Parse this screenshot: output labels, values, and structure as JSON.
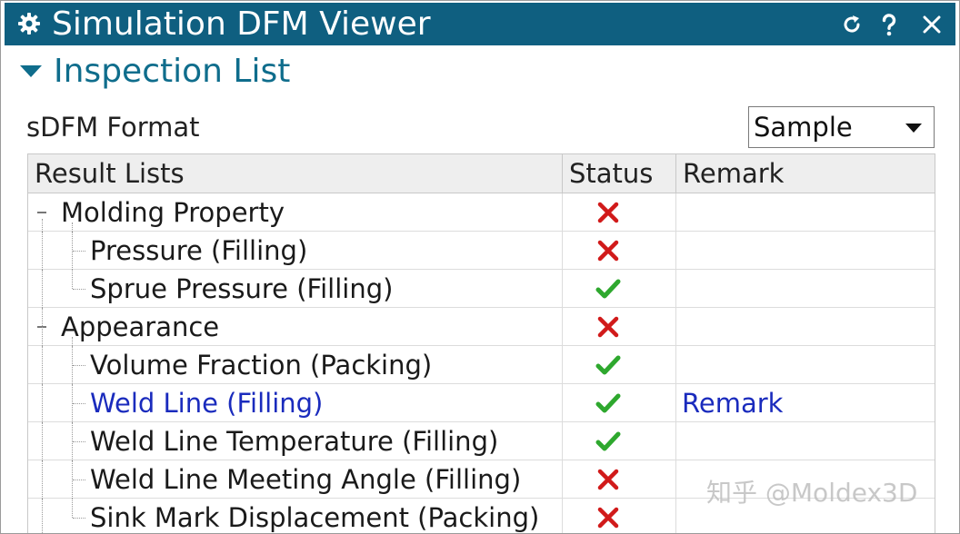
{
  "window": {
    "title": "Simulation DFM Viewer",
    "titlebar_color": "#0f5f80",
    "icons": [
      "gear-icon",
      "reset-icon",
      "help-icon",
      "close-icon"
    ]
  },
  "section": {
    "title": "Inspection List",
    "expanded": true,
    "accent_color": "#0f6d8c"
  },
  "format": {
    "label": "sDFM Format",
    "selected": "Sample"
  },
  "table": {
    "columns": [
      "Result Lists",
      "Status",
      "Remark"
    ],
    "rows": [
      {
        "name": "Molding Property",
        "level": 0,
        "group": true,
        "status": "fail",
        "remark": ""
      },
      {
        "name": "Pressure (Filling)",
        "level": 1,
        "group": false,
        "status": "fail",
        "remark": ""
      },
      {
        "name": "Sprue Pressure (Filling)",
        "level": 1,
        "group": false,
        "status": "pass",
        "remark": ""
      },
      {
        "name": "Appearance",
        "level": 0,
        "group": true,
        "status": "fail",
        "remark": ""
      },
      {
        "name": "Volume Fraction (Packing)",
        "level": 1,
        "group": false,
        "status": "pass",
        "remark": ""
      },
      {
        "name": "Weld Line (Filling)",
        "level": 1,
        "group": false,
        "status": "pass",
        "remark": "Remark",
        "link": true
      },
      {
        "name": "Weld Line Temperature (Filling)",
        "level": 1,
        "group": false,
        "status": "pass",
        "remark": ""
      },
      {
        "name": "Weld Line Meeting Angle (Filling)",
        "level": 1,
        "group": false,
        "status": "fail",
        "remark": ""
      },
      {
        "name": "Sink Mark Displacement (Packing)",
        "level": 1,
        "group": false,
        "status": "fail",
        "remark": ""
      }
    ],
    "status_colors": {
      "pass": "#2ea82e",
      "fail": "#d11a1a"
    },
    "link_color": "#1a2bbd"
  },
  "watermark": "知乎 @Moldex3D"
}
